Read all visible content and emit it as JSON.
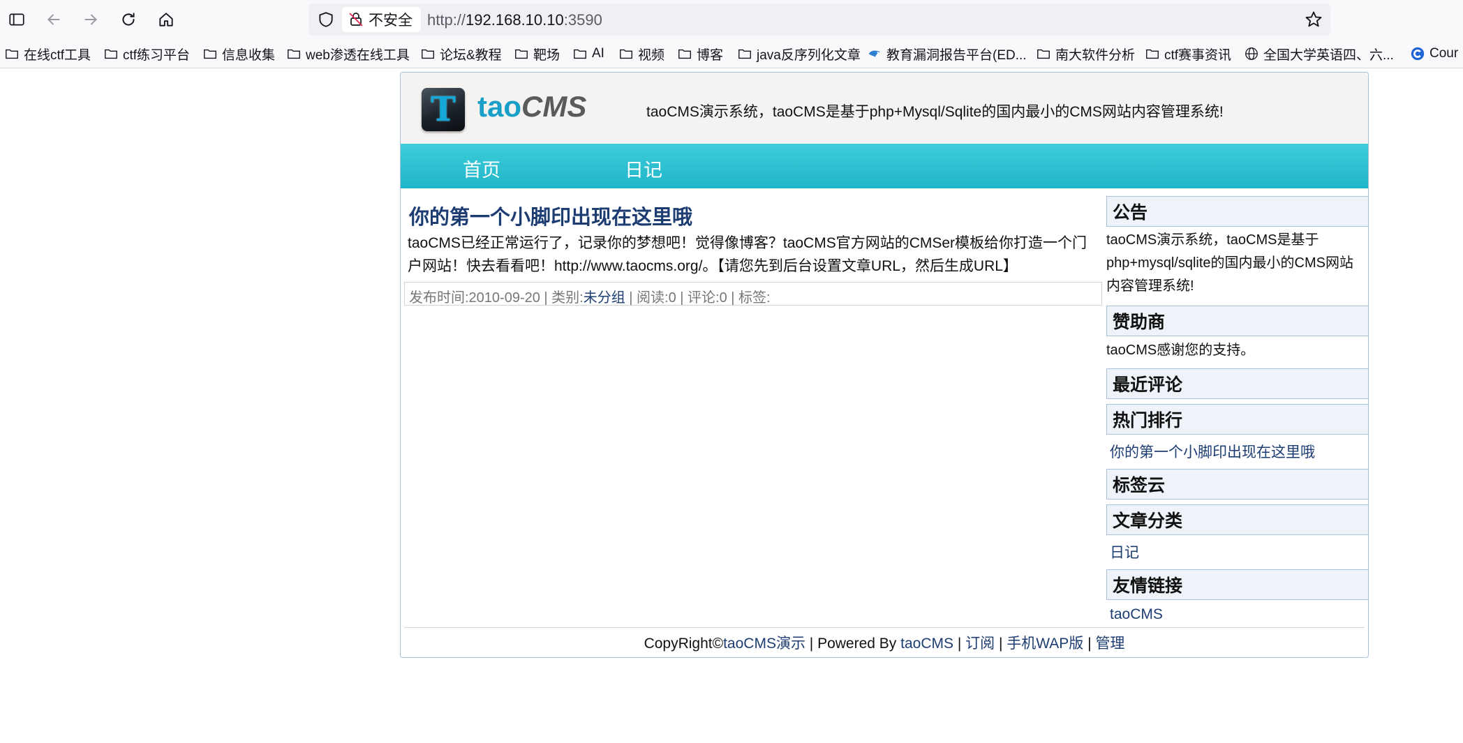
{
  "browser": {
    "not_secure_label": "不安全",
    "url_scheme": "http://",
    "url_host": "192.168.10.10",
    "url_port": ":3590",
    "bookmarks": [
      {
        "label": "在线ctf工具",
        "icon": "folder-icon"
      },
      {
        "label": "ctf练习平台",
        "icon": "folder-icon"
      },
      {
        "label": "信息收集",
        "icon": "folder-icon"
      },
      {
        "label": "web渗透在线工具",
        "icon": "folder-icon"
      },
      {
        "label": "论坛&教程",
        "icon": "folder-icon"
      },
      {
        "label": "靶场",
        "icon": "folder-icon"
      },
      {
        "label": "AI",
        "icon": "folder-icon"
      },
      {
        "label": "视频",
        "icon": "folder-icon"
      },
      {
        "label": "博客",
        "icon": "folder-icon"
      },
      {
        "label": "java反序列化文章",
        "icon": "folder-icon"
      },
      {
        "label": "教育漏洞报告平台(ED...",
        "icon": "bird-icon"
      },
      {
        "label": "南大软件分析",
        "icon": "folder-icon"
      },
      {
        "label": "ctf赛事资讯",
        "icon": "folder-icon"
      },
      {
        "label": "全国大学英语四、六...",
        "icon": "globe-icon"
      },
      {
        "label": "Cour",
        "icon": "coursera-icon"
      }
    ]
  },
  "site": {
    "logo_tao": "tao",
    "logo_cms": "CMS",
    "logo_mark": "T",
    "header_desc": "taoCMS演示系统，taoCMS是基于php+Mysql/Sqlite的国内最小的CMS网站内容管理系统!",
    "nav": [
      {
        "label": "首页"
      },
      {
        "label": "日记"
      }
    ],
    "post": {
      "title": "你的第一个小脚印出现在这里哦",
      "body_line1": "taoCMS已经正常运行了，记录你的梦想吧！觉得像博客？taoCMS官方网站的CMSer模板给你打造一个门",
      "body_line2": "户网站！快去看看吧！http://www.taocms.org/。【请您先到后台设置文章URL，然后生成URL】",
      "meta_date": "发布时间:2010-09-20 | 类别:",
      "meta_category": "未分组",
      "meta_rest": " | 阅读:0 | 评论:0 | 标签:"
    },
    "sidebar": {
      "notice_title": "公告",
      "notice_line1": "taoCMS演示系统，taoCMS是基于",
      "notice_line2": "php+mysql/sqlite的国内最小的CMS网站",
      "notice_line3": "内容管理系统!",
      "sponsor_title": "赞助商",
      "sponsor_text": "taoCMS感谢您的支持。",
      "recent_comments_title": "最近评论",
      "hot_title": "热门排行",
      "hot_item": "你的第一个小脚印出现在这里哦",
      "tags_title": "标签云",
      "categories_title": "文章分类",
      "category_item": "日记",
      "links_title": "友情链接",
      "link_item": "taoCMS"
    },
    "footer": {
      "copyright": "CopyRight©",
      "demo_link": "taoCMS演示",
      "powered": " | Powered By ",
      "powered_link": "taoCMS",
      "sep": " | ",
      "subscribe": "订阅",
      "wap": "手机WAP版",
      "admin": "管理"
    }
  }
}
